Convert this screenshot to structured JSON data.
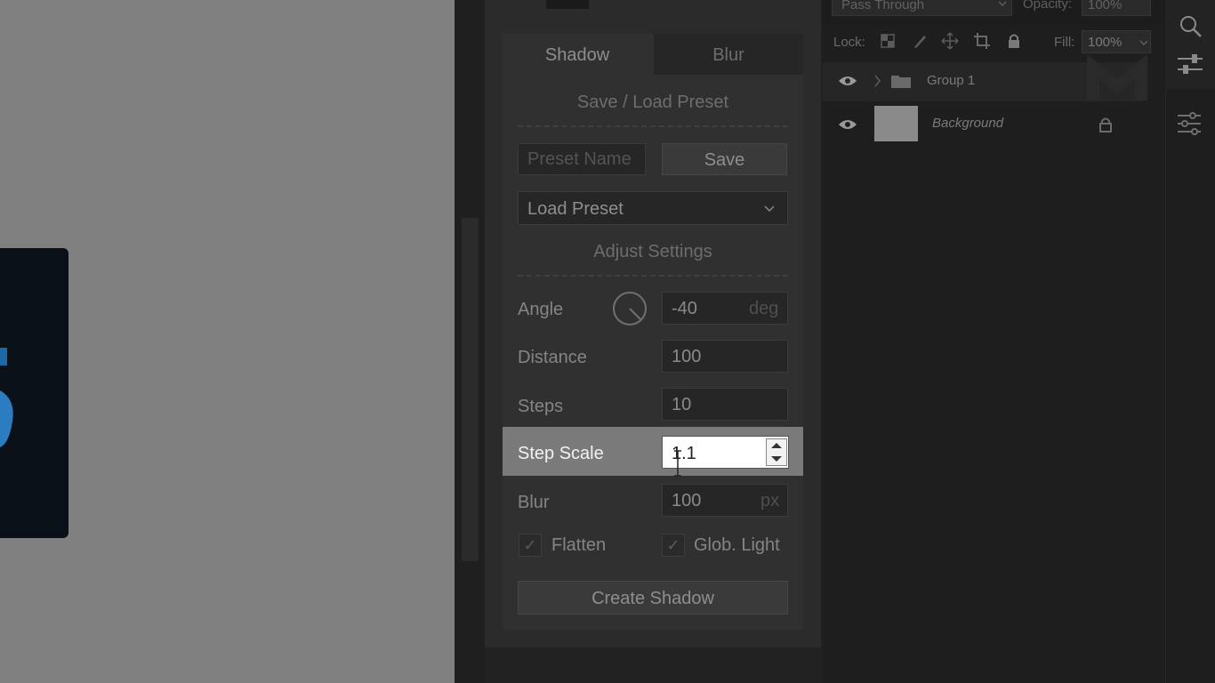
{
  "canvas": {
    "card_glyph_icon": "partial-blue-glyph"
  },
  "panel": {
    "tabs": [
      {
        "label": "Shadow"
      },
      {
        "label": "Blur"
      }
    ],
    "preset_section": {
      "title": "Save / Load Preset",
      "preset_name_placeholder": "Preset Name",
      "save_label": "Save",
      "load_preset_value": "Load Preset"
    },
    "adjust_section": {
      "title": "Adjust Settings"
    },
    "fields": {
      "angle": {
        "label": "Angle",
        "value": "-40",
        "unit": "deg"
      },
      "distance": {
        "label": "Distance",
        "value": "100"
      },
      "steps": {
        "label": "Steps",
        "value": "10"
      },
      "step_scale": {
        "label": "Step Scale",
        "value": "1.1"
      },
      "blur": {
        "label": "Blur",
        "value": "100",
        "unit": "px"
      }
    },
    "checkboxes": {
      "flatten": {
        "label": "Flatten",
        "checked": true
      },
      "glob_light": {
        "label": "Glob. Light",
        "checked": true
      }
    },
    "create_label": "Create Shadow"
  },
  "layers": {
    "blend_mode": "Pass Through",
    "opacity_label": "Opacity:",
    "opacity_value": "100%",
    "lock_label": "Lock:",
    "fill_label": "Fill:",
    "fill_value": "100%",
    "items": [
      {
        "name": "Group 1"
      },
      {
        "name": "Background"
      }
    ]
  },
  "colors": {
    "highlight": "#7a7a7a",
    "panel": "#2b2b2b",
    "canvas": "#808080"
  }
}
